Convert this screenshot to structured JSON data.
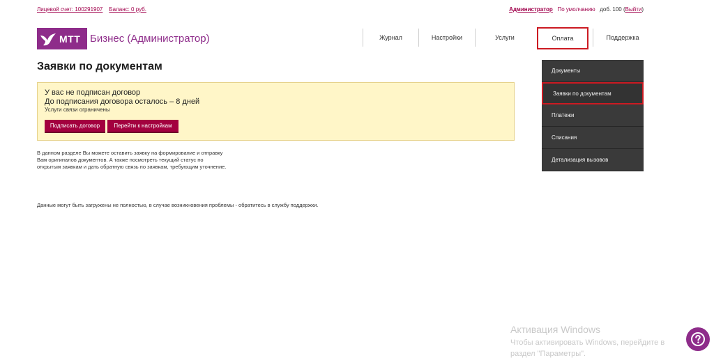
{
  "topbar": {
    "account": "Лицевой счет: 100291907",
    "balance": "Баланс: 0 руб.",
    "admin": "Администратор",
    "default": "По умолчанию",
    "ext_prefix": "доб. 100 (",
    "logout": "Выйти",
    "ext_suffix": ")"
  },
  "logo": {
    "brand": "МТТ",
    "product": "Бизнес (Администратор)"
  },
  "nav": {
    "items": [
      {
        "label": "Журнал"
      },
      {
        "label": "Настройки"
      },
      {
        "label": "Услуги"
      },
      {
        "label": "Оплата",
        "active": true
      },
      {
        "label": "Поддержка"
      }
    ]
  },
  "page": {
    "title": "Заявки по документам"
  },
  "warning": {
    "line1": "У вас не подписан договор",
    "line2": "До подписания договора осталось – 8 дней",
    "line3": "Услуги связи ограничены",
    "sign_button": "Подписать договор",
    "settings_button": "Перейти к настройкам"
  },
  "info": {
    "line1": "В данном разделе Вы можете оставить заявку на формирование и отправку",
    "line2": "Вам оригиналов документов. А также посмотреть текущий статус по",
    "line3": "открытым заявкам и дать обратную связь по заявкам, требующим уточнение."
  },
  "notice": "Данные могут быть загружены не полностью, в случае возникновения проблемы - обратитесь в службу поддержки.",
  "sidemenu": {
    "items": [
      {
        "label": "Документы"
      },
      {
        "label": "Заявки по документам",
        "active": true
      },
      {
        "label": "Платежи"
      },
      {
        "label": "Списания"
      },
      {
        "label": "Детализация вызовов"
      }
    ]
  },
  "watermark": {
    "title": "Активация Windows",
    "line1": "Чтобы активировать Windows, перейдите в",
    "line2": "раздел \"Параметры\"."
  },
  "colors": {
    "brand": "#8e2c8a",
    "accent": "#a3003f",
    "highlight": "#cc1a22",
    "warning_bg": "#fff6c8"
  },
  "icons": {
    "help": "question-icon",
    "logo": "bird-icon"
  }
}
